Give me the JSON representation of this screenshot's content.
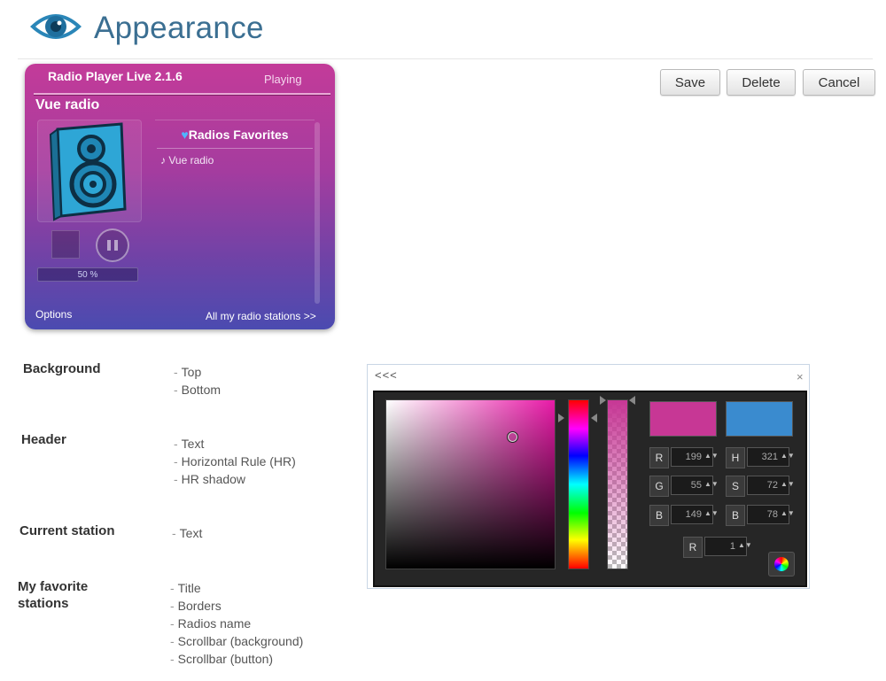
{
  "header": {
    "title": "Appearance",
    "icon": "eye-icon"
  },
  "toolbar": {
    "save_label": "Save",
    "delete_label": "Delete",
    "cancel_label": "Cancel"
  },
  "player": {
    "app_name": "Radio Player Live 2.1.6",
    "status": "Playing",
    "station": "Vue radio",
    "volume": "50 %",
    "favorites_title": "Radios Favorites",
    "favorite_item": "Vue radio",
    "options_label": "Options",
    "all_stations_label": "All my radio stations >>",
    "colors": {
      "top": "#c33b99",
      "bottom": "#4b4bb0",
      "speaker": "#2ea6d6"
    }
  },
  "settings": {
    "background": {
      "label": "Background",
      "options": [
        "Top",
        "Bottom"
      ]
    },
    "header": {
      "label": "Header",
      "options": [
        "Text",
        "Horizontal Rule (HR)",
        "HR shadow"
      ]
    },
    "current_station": {
      "label": "Current station",
      "options": [
        "Text"
      ]
    },
    "favorites": {
      "label_line1": "My favorite",
      "label_line2": "stations",
      "options": [
        "Title",
        "Borders",
        "Radios name",
        "Scrollbar (background)",
        "Scrollbar (button)"
      ]
    }
  },
  "color_picker": {
    "back_label": "<<<",
    "close_label": "×",
    "new_color": "#c73795",
    "current_color": "#3a8bcf",
    "fields": {
      "r": {
        "label": "R",
        "value": "199"
      },
      "g": {
        "label": "G",
        "value": "55"
      },
      "b": {
        "label": "B",
        "value": "149"
      },
      "h": {
        "label": "H",
        "value": "321"
      },
      "s": {
        "label": "S",
        "value": "72"
      },
      "v": {
        "label": "B",
        "value": "78"
      },
      "a": {
        "label": "R",
        "value": "1"
      }
    }
  }
}
